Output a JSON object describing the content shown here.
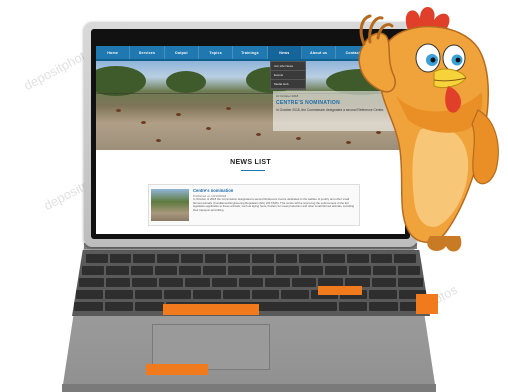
{
  "nav": {
    "items": [
      "Home",
      "Services",
      "Output",
      "Topics",
      "Trainings",
      "News",
      "About us",
      "Contact",
      "External links"
    ]
  },
  "dropdown": {
    "items": [
      "Acc.Life News",
      "Events",
      "Media Hub"
    ]
  },
  "hero": {
    "date": "10 October 2018",
    "title": "CENTRE'S NOMINATION",
    "text": "In October 2018, the Commission designated a second Reference Centre."
  },
  "news": {
    "title": "NEWS LIST",
    "card": {
      "headline": "Centre's nomination",
      "date": "Published on 10/10/2018",
      "body": "In October of 2018 the Commission designated a second Reference Centre dedicated to the welfare of poultry and other small farmed animals (Conditioned Engineering Regulation (EU) 2017/625). This centre will be improving the enforcement of the EU legislation applicable to these animals, such as laying hens, broilers for meat production and other small farmed animals, including their transport and killing."
    }
  },
  "colors": {
    "nav": "#1f78b0",
    "accent_keys": "#f07a1c",
    "laptop": "#a4a4a4"
  }
}
